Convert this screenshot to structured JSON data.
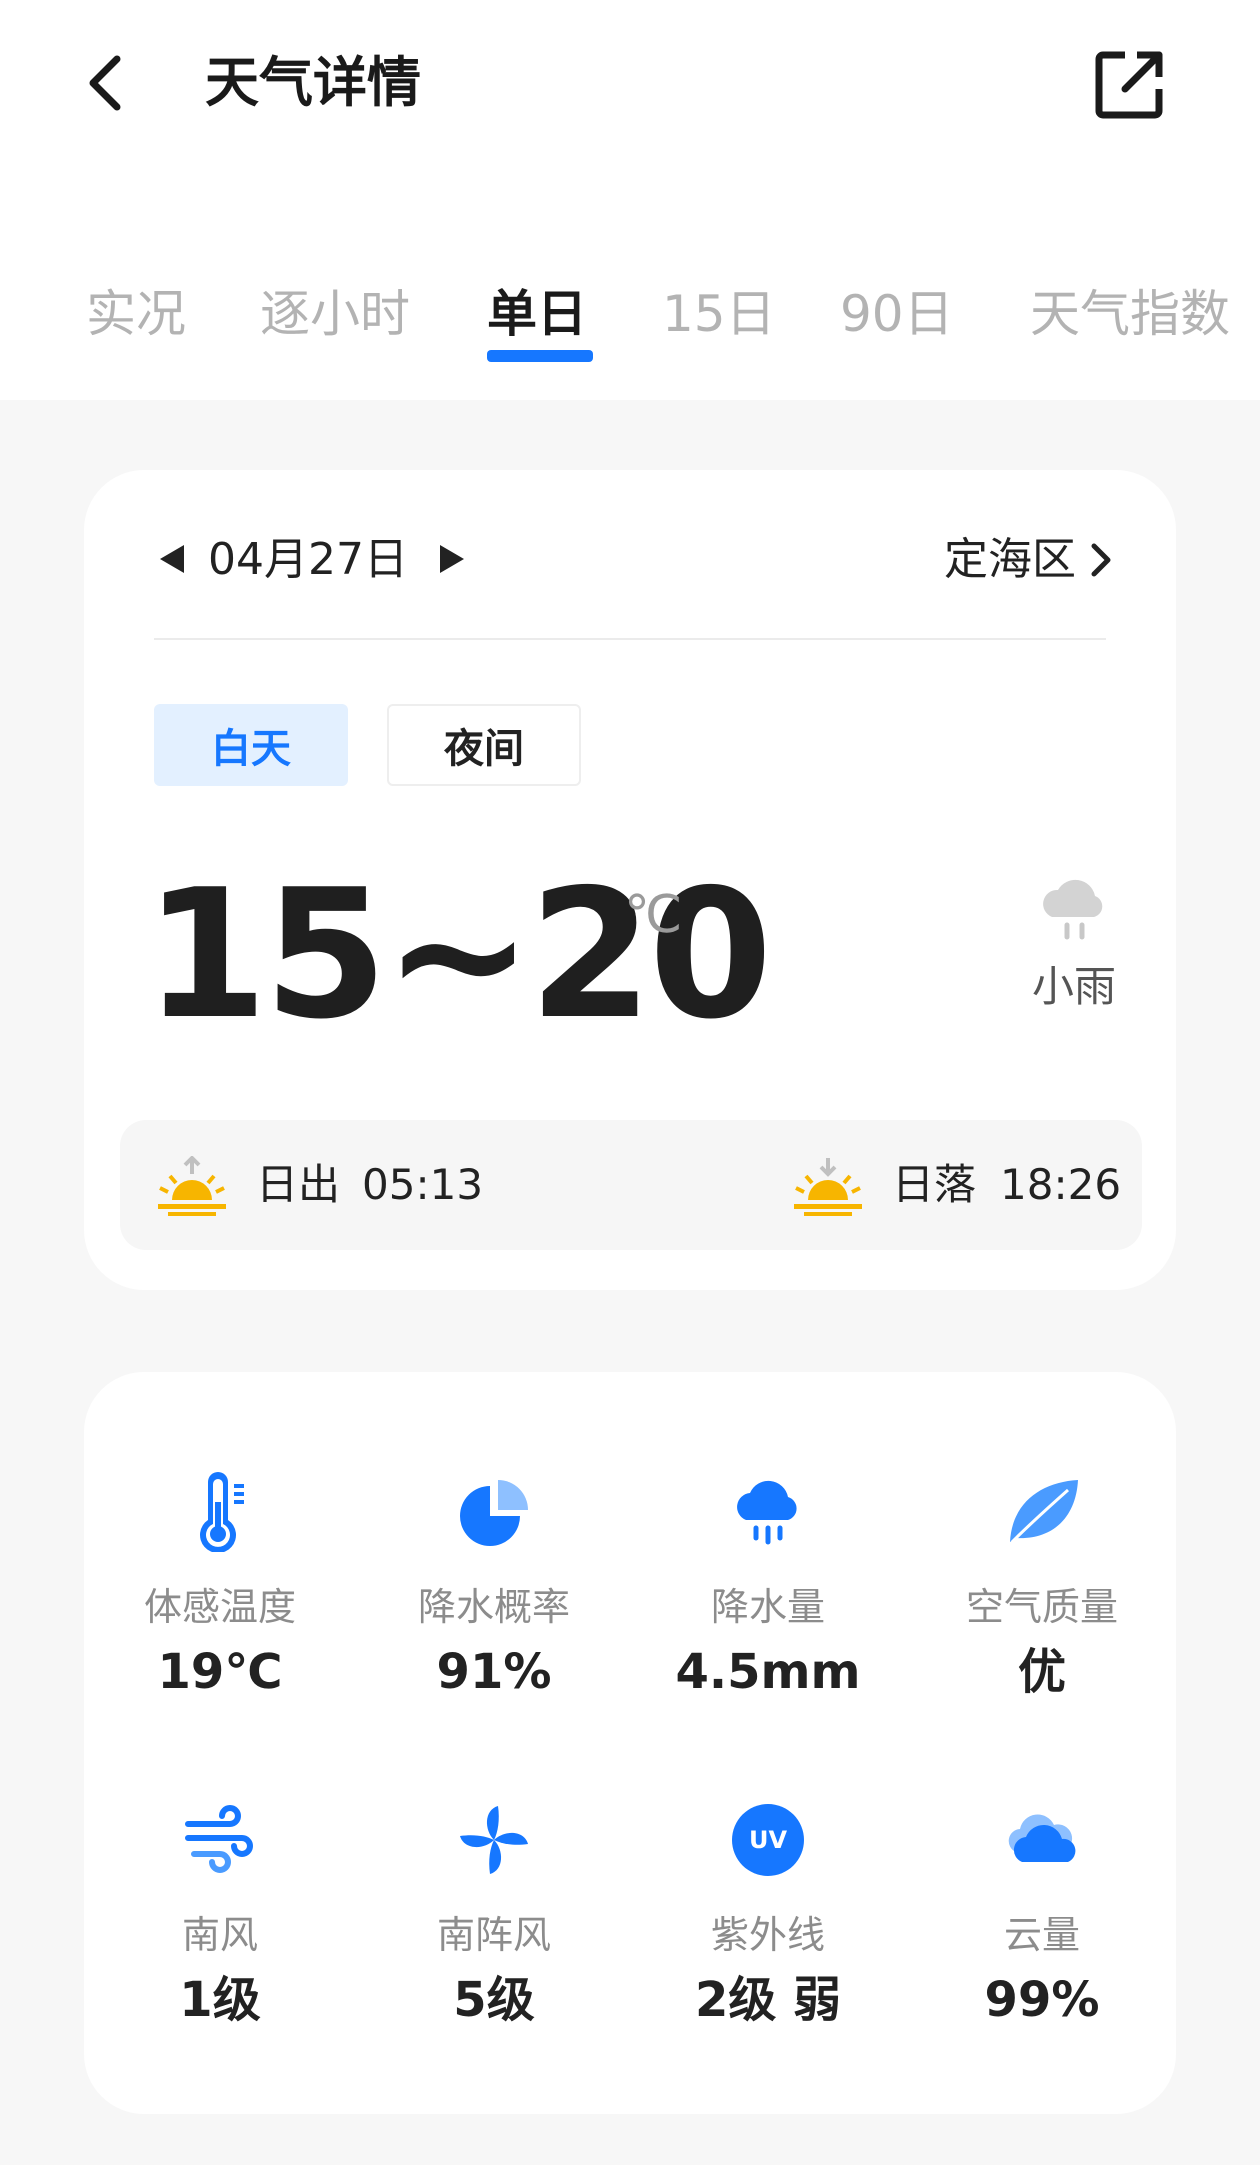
{
  "header": {
    "title": "天气详情"
  },
  "tabs": [
    {
      "label": "实况",
      "active": false
    },
    {
      "label": "逐小时",
      "active": false
    },
    {
      "label": "单日",
      "active": true
    },
    {
      "label": "15日",
      "active": false
    },
    {
      "label": "90日",
      "active": false
    },
    {
      "label": "天气指数",
      "active": false
    }
  ],
  "summary": {
    "date": "04月27日",
    "location": "定海区",
    "day_label": "白天",
    "night_label": "夜间",
    "selected": "白天",
    "temp_range": "15~20",
    "temp_unit": "℃",
    "condition": "小雨",
    "condition_icon": "light-rain-icon",
    "sunrise_label": "日出",
    "sunrise_time": "05:13",
    "sunset_label": "日落",
    "sunset_time": "18:26"
  },
  "metrics": [
    {
      "label": "体感温度",
      "value": "19℃",
      "icon": "thermometer-icon"
    },
    {
      "label": "降水概率",
      "value": "91%",
      "icon": "pie-chart-icon"
    },
    {
      "label": "降水量",
      "value": "4.5mm",
      "icon": "rain-cloud-icon"
    },
    {
      "label": "空气质量",
      "value": "优",
      "icon": "leaf-icon"
    },
    {
      "label": "南风",
      "value": "1级",
      "icon": "wind-icon"
    },
    {
      "label": "南阵风",
      "value": "5级",
      "icon": "gust-fan-icon"
    },
    {
      "label": "紫外线",
      "value": "2级 弱",
      "icon": "uv-icon"
    },
    {
      "label": "云量",
      "value": "99%",
      "icon": "cloud-icon"
    }
  ],
  "colors": {
    "accent": "#1677ff",
    "sun": "#f7b500",
    "muted_tab": "#b3b3b3"
  }
}
